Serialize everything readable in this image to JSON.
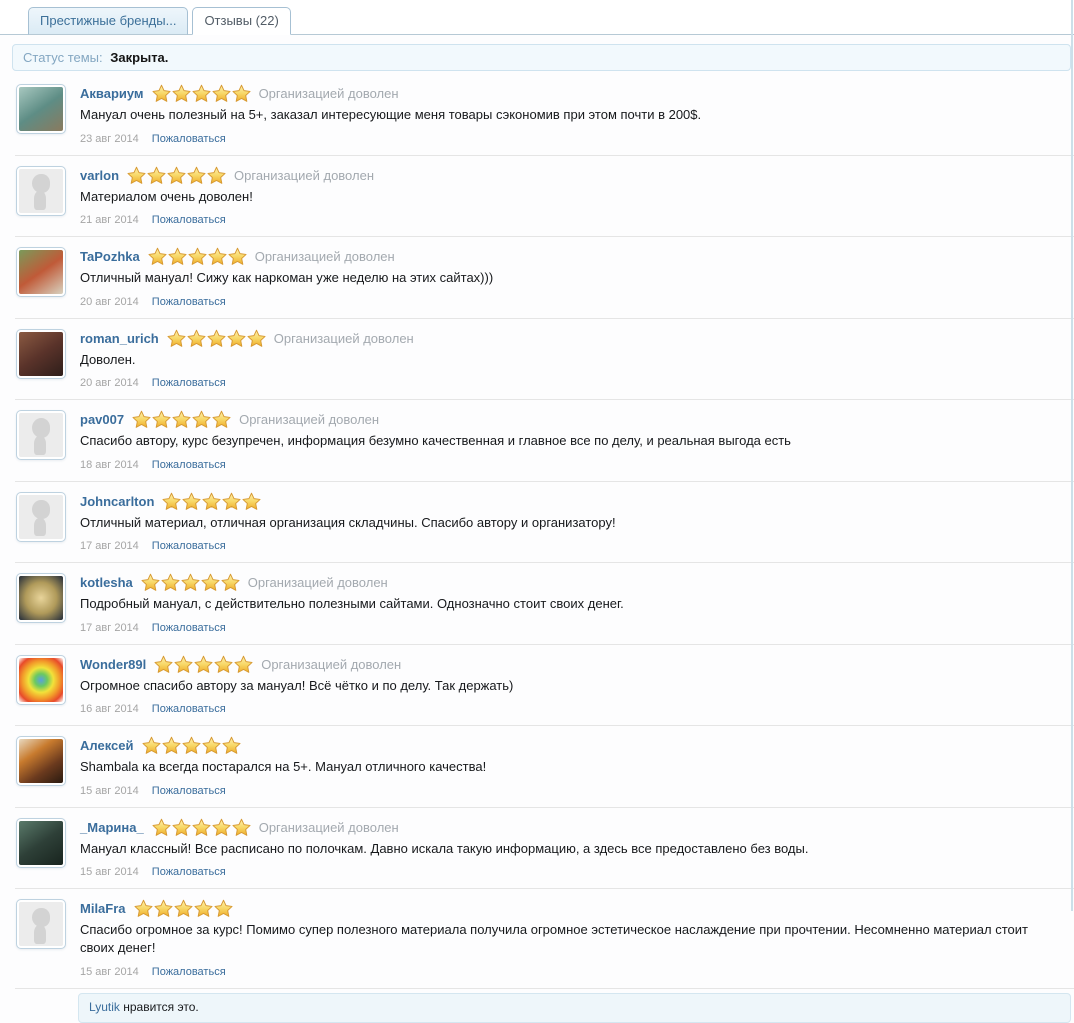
{
  "tabs": [
    {
      "label": "Престижные бренды...",
      "active": false
    },
    {
      "label": "Отзывы (22)",
      "active": true
    }
  ],
  "status": {
    "label": "Статус темы:",
    "value": "Закрыта."
  },
  "review_defaults": {
    "org_label": "Организацией доволен",
    "report_label": "Пожаловаться"
  },
  "icons": {
    "star": "★"
  },
  "colors": {
    "link": "#3a6d9c",
    "star_fill_top": "#fdf0b0",
    "star_fill_mid": "#f8d868",
    "star_fill_bottom": "#eead2a",
    "star_stroke": "#d79a33",
    "tab_inactive_bg": "#e4f0f8",
    "status_bg": "#f2f9fd",
    "likes_bg": "#eef6fa"
  },
  "reviews": [
    {
      "username": "Аквариум",
      "stars": 5,
      "org": true,
      "text": "Мануал очень полезный на 5+, заказал интересующие меня товары сэкономив при этом почти в 200$.",
      "date": "23 авг 2014",
      "avatar": {
        "type": "gradient",
        "colors": [
          "#a8c8c0",
          "#5e8d85",
          "#8a7a5e"
        ]
      }
    },
    {
      "username": "varlon",
      "stars": 5,
      "org": true,
      "text": "Материалом очень доволен!",
      "date": "21 авг 2014",
      "avatar": {
        "type": "silhouette"
      }
    },
    {
      "username": "TaPozhka",
      "stars": 5,
      "org": true,
      "text": "Отличный мануал! Сижу как наркоман уже неделю на этих сайтах)))",
      "date": "20 авг 2014",
      "avatar": {
        "type": "gradient",
        "colors": [
          "#7a9a5a",
          "#c05a38",
          "#d8d2c0"
        ]
      }
    },
    {
      "username": "roman_urich",
      "stars": 5,
      "org": true,
      "text": "Доволен.",
      "date": "20 авг 2014",
      "avatar": {
        "type": "gradient",
        "colors": [
          "#8a5a42",
          "#5a332a",
          "#2e1e1a"
        ]
      }
    },
    {
      "username": "pav007",
      "stars": 5,
      "org": true,
      "text": "Спасибо автору, курс безупречен, информация безумно качественная и главное все по делу, и реальная выгода есть",
      "date": "18 авг 2014",
      "avatar": {
        "type": "silhouette"
      }
    },
    {
      "username": "Johncarlton",
      "stars": 5,
      "org": false,
      "text": "Отличный материал, отличная организация складчины. Спасибо автору и организатору!",
      "date": "17 авг 2014",
      "avatar": {
        "type": "silhouette"
      }
    },
    {
      "username": "kotlesha",
      "stars": 5,
      "org": true,
      "text": "Подробный мануал, с действительно полезными сайтами. Однозначно стоит своих денег.",
      "date": "17 авг 2014",
      "avatar": {
        "type": "radial",
        "colors": [
          "#e8d49a",
          "#b09a5a",
          "#232c3a"
        ]
      }
    },
    {
      "username": "Wonder89l",
      "stars": 5,
      "org": true,
      "text": "Огромное спасибо автору за мануал! Всё чётко и по делу. Так держать)",
      "date": "16 авг 2014",
      "avatar": {
        "type": "radial",
        "colors": [
          "#5a9fe0",
          "#6cc95f",
          "#f2e23a",
          "#f29c2a",
          "#e84a2a",
          "#ffffff"
        ]
      }
    },
    {
      "username": "Алексей",
      "stars": 5,
      "org": false,
      "text": "Shambala ка всегда постарался на 5+. Мануал отличного качества!",
      "date": "15 авг 2014",
      "avatar": {
        "type": "gradient",
        "colors": [
          "#e8d9c0",
          "#c87b2e",
          "#6b3a1e",
          "#2a1a10"
        ]
      }
    },
    {
      "username": "_Марина_",
      "stars": 5,
      "org": true,
      "text": "Мануал классный! Все расписано по полочкам. Давно искала такую информацию, а здесь все предоставлено без воды.",
      "date": "15 авг 2014",
      "avatar": {
        "type": "gradient",
        "colors": [
          "#5a7a6a",
          "#2e4038",
          "#18241e"
        ]
      }
    },
    {
      "username": "MilaFra",
      "stars": 5,
      "org": false,
      "text": "Спасибо огромное за курс! Помимо супер полезного материала получила огромное эстетическое наслаждение при прочтении. Несомненно материал стоит своих денег!",
      "date": "15 авг 2014",
      "avatar": {
        "type": "silhouette"
      },
      "likes": {
        "user": "Lyutik",
        "text": "нравится это."
      }
    }
  ]
}
